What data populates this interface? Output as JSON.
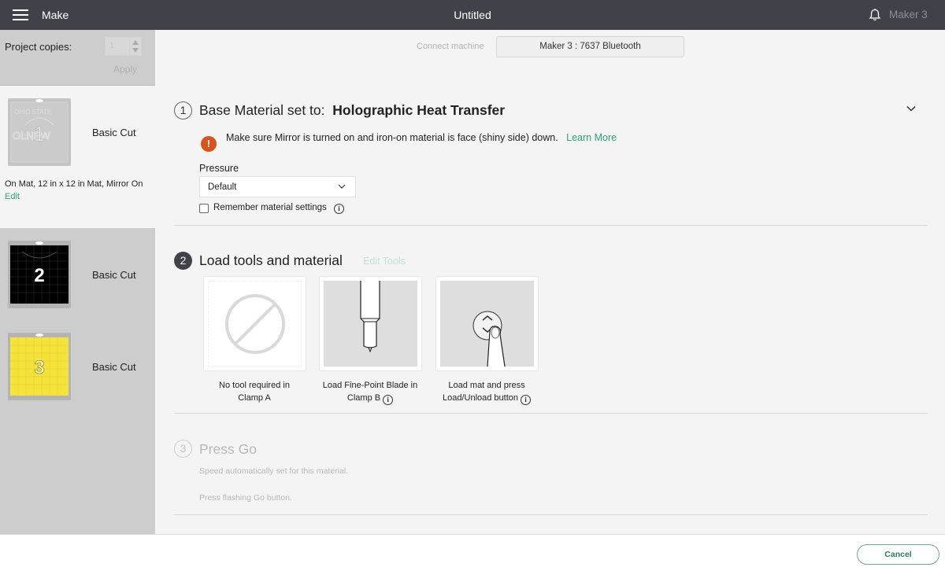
{
  "topbar": {
    "menu_icon": "hamburger-icon",
    "app_name": "Make",
    "document_title": "Untitled",
    "notification_icon": "bell-icon",
    "machine_name": "Maker 3"
  },
  "sidebar": {
    "project_copies_label": "Project copies:",
    "project_copies_value": "1",
    "apply_label": "Apply",
    "mats": [
      {
        "number": "1",
        "label": "Basic Cut",
        "info": "On Mat, 12 in x 12 in Mat, Mirror On",
        "edit_label": "Edit",
        "color": "#c8c8c8",
        "active": true
      },
      {
        "number": "2",
        "label": "Basic Cut",
        "color": "#000000",
        "active": false
      },
      {
        "number": "3",
        "label": "Basic Cut",
        "color": "#f5e33b",
        "active": false
      }
    ]
  },
  "connect": {
    "label": "Connect machine",
    "button_label": "Maker 3 : 7637 Bluetooth"
  },
  "step1": {
    "number": "1",
    "title_prefix": "Base Material set to:",
    "material": "Holographic Heat Transfer",
    "warning_text": "Make sure Mirror is turned on and iron-on material is face (shiny side) down.",
    "learn_more_label": "Learn More",
    "pressure_label": "Pressure",
    "pressure_value": "Default",
    "remember_label": "Remember material settings",
    "remember_checked": false
  },
  "step2": {
    "number": "2",
    "title": "Load tools and material",
    "edit_tools_label": "Edit Tools",
    "tools": [
      {
        "caption_line1": "No tool required in",
        "caption_line2": "Clamp A",
        "icon": "no-tool-icon",
        "has_info": false
      },
      {
        "caption_line1": "Load Fine-Point Blade in",
        "caption_line2": "Clamp B",
        "icon": "fine-point-blade-icon",
        "has_info": true
      },
      {
        "caption_line1": "Load mat and press",
        "caption_line2": "Load/Unload button",
        "icon": "load-unload-button-icon",
        "has_info": true
      }
    ]
  },
  "step3": {
    "number": "3",
    "title": "Press Go",
    "line1": "Speed automatically set for this material.",
    "line2": "Press flashing Go button."
  },
  "footer": {
    "cancel_label": "Cancel"
  },
  "colors": {
    "topbar_bg": "#3f4349",
    "accent_green": "#2ea176",
    "warning_orange": "#d7541f",
    "sidebar_bg": "#cdcdcd",
    "main_bg": "#f4f4f4"
  }
}
